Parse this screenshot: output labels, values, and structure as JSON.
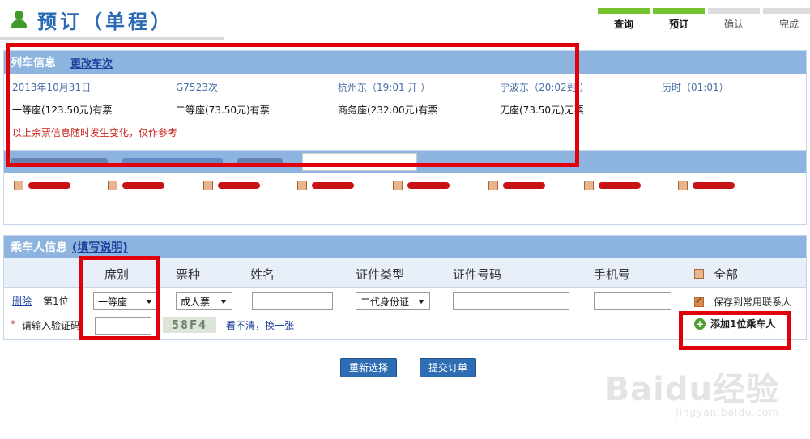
{
  "header": {
    "title": "预订（单程）"
  },
  "steps": [
    {
      "label": "查询",
      "done": true
    },
    {
      "label": "预订",
      "done": true
    },
    {
      "label": "确认",
      "done": false
    },
    {
      "label": "完成",
      "done": false
    }
  ],
  "train_info": {
    "heading": "列车信息",
    "change_link": "更改车次",
    "date": "2013年10月31日",
    "train_no": "G7523次",
    "depart": "杭州东（19:01  开  ）",
    "arrive": "宁波东（20:02到  ）",
    "duration": "历时（01:01）",
    "seats": [
      "一等座(123.50元)有票",
      "二等座(73.50元)有票",
      "商务座(232.00元)有票",
      "无座(73.50元)无票"
    ],
    "notice": "以上余票信息随时发生变化，仅作参考"
  },
  "passenger": {
    "heading": "乘车人信息",
    "help_link": "(填写说明)",
    "columns": [
      "席别",
      "票种",
      "姓名",
      "证件类型",
      "证件号码",
      "手机号",
      "全部"
    ],
    "row": {
      "delete_label": "删除",
      "index_label": "第1位",
      "seat": "一等座",
      "ticket_type": "成人票",
      "id_type": "二代身份证",
      "save_label": "保存到常用联系人"
    },
    "captcha_label": "请输入验证码：",
    "captcha_text": "58F4",
    "refresh_label": "看不清，换一张",
    "add_label": "添加1位乘车人"
  },
  "buttons": {
    "reset": "重新选择",
    "submit": "提交订单"
  },
  "watermark": {
    "brand": "Baidu经验",
    "url": "jingyan.baidu.com"
  },
  "colors": {
    "accent": "#2e6db4",
    "panel_header": "#8db4df",
    "annotation": "#e0000b",
    "progress": "#74c32f"
  }
}
